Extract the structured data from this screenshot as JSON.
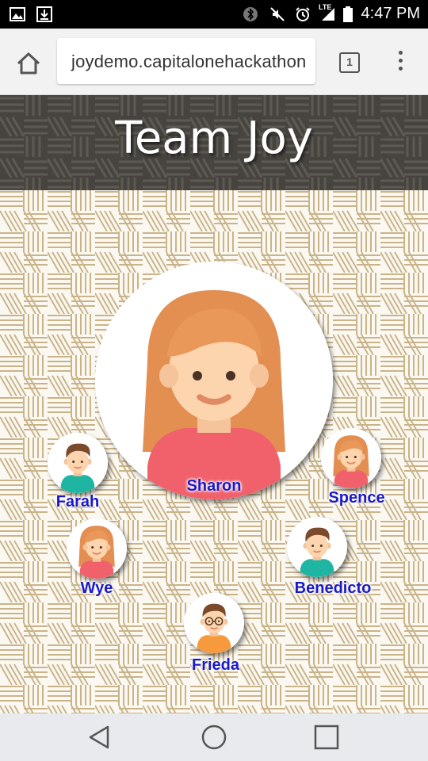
{
  "status_bar": {
    "time": "4:47 PM",
    "network_label": "LTE",
    "icons": [
      "image-notification-icon",
      "download-notification-icon",
      "bluetooth-icon",
      "mute-icon",
      "alarm-icon",
      "signal-icon",
      "battery-icon"
    ]
  },
  "browser": {
    "url": "joydemo.capitalonehackathon",
    "tab_count": "1"
  },
  "header": {
    "title": "Team Joy"
  },
  "members": {
    "main": {
      "name": "Sharon",
      "avatar": "girl-avatar"
    },
    "farah": {
      "name": "Farah",
      "avatar": "boy-avatar"
    },
    "spence": {
      "name": "Spence",
      "avatar": "girl-avatar"
    },
    "wye": {
      "name": "Wye",
      "avatar": "girl-avatar"
    },
    "benedicto": {
      "name": "Benedicto",
      "avatar": "boy-avatar"
    },
    "frieda": {
      "name": "Frieda",
      "avatar": "boy-glasses-avatar"
    }
  },
  "colors": {
    "name_text": "#1a18c9",
    "header_bg": "#4a4742",
    "pattern_line": "#c9b48a"
  }
}
